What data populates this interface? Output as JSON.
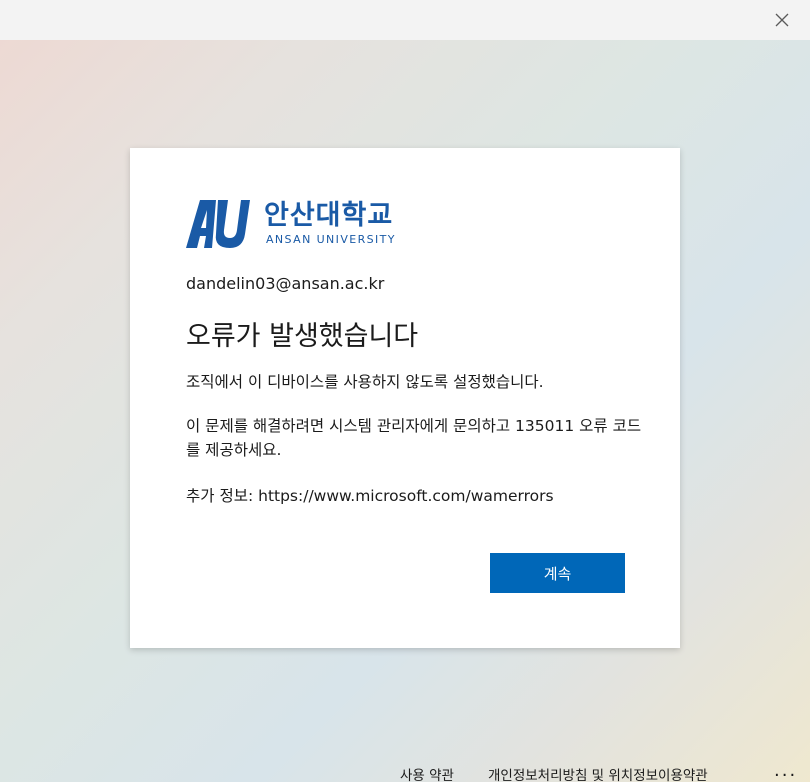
{
  "logo": {
    "korean_name": "안산대학교",
    "english_name": "ANSAN UNIVERSITY",
    "brand_color": "#1a5aa6"
  },
  "account": {
    "email": "dandelin03@ansan.ac.kr"
  },
  "error": {
    "title": "오류가 발생했습니다",
    "message": "조직에서 이 디바이스를 사용하지 않도록 설정했습니다.",
    "instruction": "이 문제를 해결하려면 시스템 관리자에게 문의하고 135011 오류 코드를 제공하세요.",
    "more_info": "추가 정보: https://www.microsoft.com/wamerrors"
  },
  "actions": {
    "continue_label": "계속",
    "button_color": "#0067b8"
  },
  "footer": {
    "terms_label": "사용 약관",
    "privacy_label": "개인정보처리방침 및 위치정보이용약관",
    "more_label": "..."
  },
  "icons": {
    "close": "close-icon",
    "logo": "au-logo-icon"
  }
}
